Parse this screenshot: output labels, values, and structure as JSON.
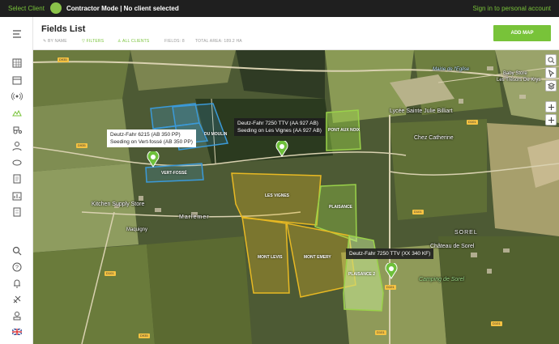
{
  "topbar": {
    "select_client": "Select Client",
    "mode": "Contractor Mode | No client selected",
    "signin": "Sign in to personal account"
  },
  "header": {
    "title": "Fields List",
    "filters": {
      "by_name": "BY NAME",
      "filters": "FILTERS",
      "all_clients": "ALL CLIENTS",
      "fields": "FIELDS: 8",
      "total_area": "TOTAL AREA: 189.2 HA"
    },
    "add_map": "ADD MAP"
  },
  "map": {
    "tooltips": {
      "t1_line1": "Deutz-Fahr 6215 (AB 350 PP)",
      "t1_line2": "Seeding on Vert-fossé (AB 350 PP)",
      "t2_line1": "Deutz-Fahr 7250 TTV (AA 927 AB)",
      "t2_line2": "Seeding on Les Vignes (AA 927 AB)",
      "t3": "Deutz-Fahr 7250 TTV (XX 340 KF)"
    },
    "fields": {
      "vert_fosse": "VERT-FOSSÉ",
      "moulin": "DU MOULIN",
      "pont_aux_noix": "PONT AUX NOIX",
      "les_vignes": "LES VIGNES",
      "plaisance": "PLAISANCE",
      "mont_levis": "MONT LEVIS",
      "mont_emery": "MONT EMERY",
      "plaisance2": "PLAISANCE 2"
    },
    "places": {
      "mairie": "Mairie de\nl'Eglise",
      "baby_store": "Baby Store",
      "tresors": "Les Trésors De Krys",
      "lycee": "Lycée Sainte Julie Billiart",
      "chez_catherine": "Chez Catherine",
      "kitchen": "Kitchen Supply Store",
      "marlemer": "Marlemer",
      "maquigny": "Maquigny",
      "sorel": "SOREL",
      "chateau": "Château de Sorel",
      "camping": "Camping de Sorel"
    },
    "roads": {
      "d935_a": "D935",
      "d935_b": "D935",
      "d101_a": "D101",
      "d101_b": "D101",
      "d101_c": "D101",
      "d101_d": "D101",
      "d101_e": "D101",
      "d101_f": "D101",
      "d935_c": "D935"
    }
  },
  "colors": {
    "accent": "#78c339",
    "field_blue": "#3b9ad9",
    "field_yellow": "#e8b923",
    "field_green": "#9ad24a"
  }
}
